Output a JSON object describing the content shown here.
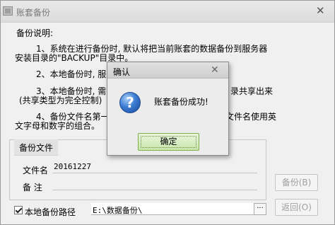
{
  "window": {
    "title": "账套备份"
  },
  "description": {
    "heading": "备份说明:",
    "line1": "1、系统在进行备份时, 默认将把当前账套的数据备份到服务器",
    "line2": "安装目录的\"BACKUP\"目录中。",
    "line3": "2、本地备份时, 服",
    "line4": "3、本地备份时, 需",
    "line4b": "录共享出来",
    "line5": "(共享类型为完全控制)",
    "line6": "4、备份文件名第一",
    "line6b": "文件名使用英",
    "line7": "文字母和数字的组合。"
  },
  "backup_group": {
    "legend": "备份文件",
    "filename_label": "文件名",
    "filename_value": "20161227",
    "note_label": "备  注",
    "note_value": ""
  },
  "buttons": {
    "backup": "备份(B)",
    "back": "返回(O)"
  },
  "local_path": {
    "label": "本地备份路径",
    "value": "E:\\数据备份\\",
    "checked": true,
    "browse": "···"
  },
  "dialog": {
    "title": "确认",
    "message": "账套备份成功!",
    "icon": "question-icon",
    "ok_label": "确定"
  }
}
